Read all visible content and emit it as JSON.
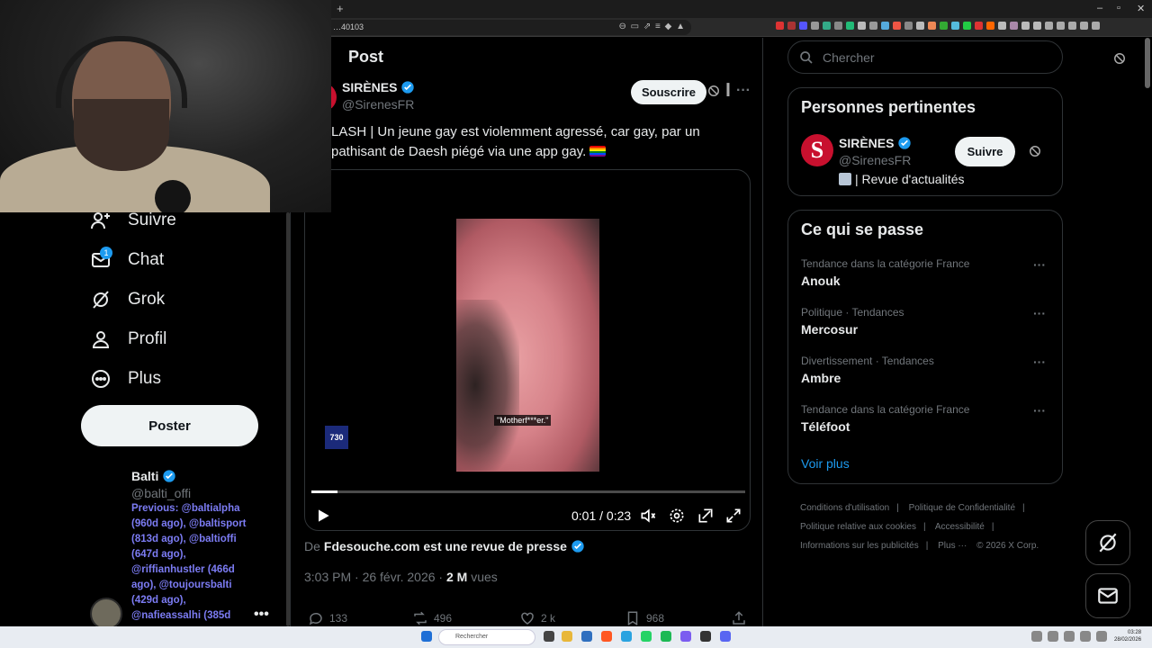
{
  "browser": {
    "url": "…40103",
    "new_tab": "+",
    "window_controls": [
      "–",
      "▫",
      "✕"
    ]
  },
  "nav": {
    "items": [
      {
        "label": "Suivre",
        "icon": "follow-icon"
      },
      {
        "label": "Chat",
        "icon": "mail-icon",
        "badge": "1"
      },
      {
        "label": "Grok",
        "icon": "grok-icon"
      },
      {
        "label": "Profil",
        "icon": "profile-icon"
      },
      {
        "label": "Plus",
        "icon": "more-icon"
      }
    ],
    "post_button": "Poster",
    "account": {
      "name": "Balti",
      "handle": "@balti_offi",
      "previous": "Previous: @baltialpha (960d ago), @baltisport (813d ago), @baltioffi (647d ago), @riffianhustler (466d ago), @toujoursbalti (429d ago), @nafieassalhi (385d",
      "more": "•••"
    }
  },
  "post": {
    "page_title": "Post",
    "author_name": "SIRÈNES",
    "author_handle": "@SirenesFR",
    "subscribe_label": "Souscrire",
    "text": "LASH | Un jeune gay est violemment agressé, car gay, par un pathisant de Daesh piégé via une app gay.",
    "video": {
      "caption": "\"Motherf***er.\"",
      "logo": "730",
      "time": "0:01 / 0:23",
      "progress": 0.06
    },
    "source_prefix": "De",
    "source_name": "Fdesouche.com est une revue de presse",
    "meta_time": "3:03 PM · 26 févr. 2026 ·",
    "meta_views": "2 M",
    "meta_views_label": "vues",
    "actions": {
      "replies": "133",
      "reposts": "496",
      "likes": "2 k",
      "bookmarks": "968"
    }
  },
  "sidebar": {
    "search_placeholder": "Chercher",
    "relevant": {
      "title": "Personnes pertinentes",
      "name": "SIRÈNES",
      "handle": "@SirenesFR",
      "description": "| Revue d'actualités",
      "avatar_letter": "S",
      "follow_label": "Suivre"
    },
    "trends": {
      "title": "Ce qui se passe",
      "items": [
        {
          "category": "Tendance dans la catégorie France",
          "name": "Anouk"
        },
        {
          "category": "Politique · Tendances",
          "name": "Mercosur"
        },
        {
          "category": "Divertissement · Tendances",
          "name": "Ambre"
        },
        {
          "category": "Tendance dans la catégorie France",
          "name": "Téléfoot"
        }
      ],
      "show_more": "Voir plus"
    },
    "footer": {
      "links": [
        "Conditions d'utilisation",
        "|",
        "Politique de Confidentialité",
        "|",
        "Politique relative aux cookies",
        "|",
        "Accessibilité",
        "|",
        "Informations sur les publicités",
        "|",
        "Plus ···",
        "© 2026 X Corp."
      ]
    }
  },
  "taskbar": {
    "search_placeholder": "Rechercher",
    "time": "03:28",
    "date": "28/02/2026"
  },
  "colors": {
    "accent": "#1d9bf0",
    "brand_red": "#c8102e",
    "background": "#000000"
  }
}
